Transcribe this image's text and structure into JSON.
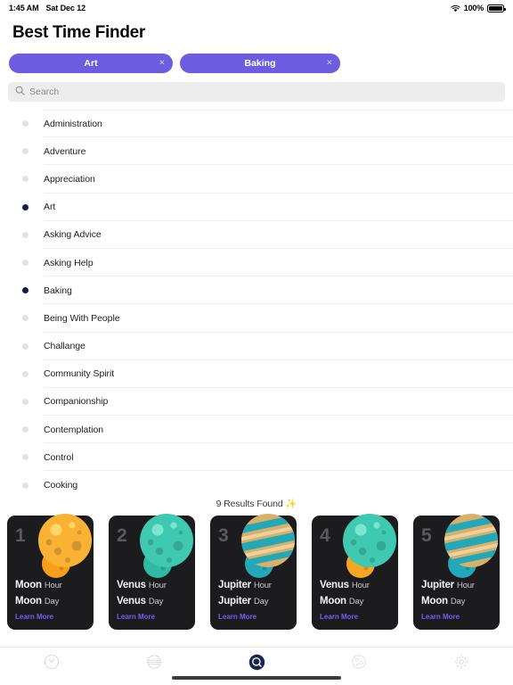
{
  "statusbar": {
    "time": "1:45 AM",
    "date": "Sat Dec 12",
    "battery_pct": "100%",
    "wifi_icon": "wifi-icon",
    "battery_icon": "battery-full-icon"
  },
  "header": {
    "title": "Best Time Finder"
  },
  "chips": [
    {
      "label": "Art",
      "remove_icon": "×"
    },
    {
      "label": "Baking",
      "remove_icon": "×"
    }
  ],
  "search": {
    "placeholder": "Search",
    "value": "",
    "icon": "search-icon"
  },
  "list": {
    "items": [
      {
        "label": "Administration",
        "selected": false
      },
      {
        "label": "Adventure",
        "selected": false
      },
      {
        "label": "Appreciation",
        "selected": false
      },
      {
        "label": "Art",
        "selected": true
      },
      {
        "label": "Asking Advice",
        "selected": false
      },
      {
        "label": "Asking Help",
        "selected": false
      },
      {
        "label": "Baking",
        "selected": true
      },
      {
        "label": "Being With People",
        "selected": false
      },
      {
        "label": "Challange",
        "selected": false
      },
      {
        "label": "Community Spirit",
        "selected": false
      },
      {
        "label": "Companionship",
        "selected": false
      },
      {
        "label": "Contemplation",
        "selected": false
      },
      {
        "label": "Control",
        "selected": false
      },
      {
        "label": "Cooking",
        "selected": false
      }
    ]
  },
  "results": {
    "text": "9 Results Found",
    "sparkle": "✨"
  },
  "cards": [
    {
      "number": "1",
      "hour_planet": "Moon",
      "hour_unit": "Hour",
      "day_planet": "Moon",
      "day_unit": "Day",
      "learn_more": "Learn More",
      "planet_main": "#F9B233",
      "planet_main_light": "#FFD76A",
      "planet_second": "#F79E1B"
    },
    {
      "number": "2",
      "hour_planet": "Venus",
      "hour_unit": "Hour",
      "day_planet": "Venus",
      "day_unit": "Day",
      "learn_more": "Learn More",
      "planet_main": "#3FC9B0",
      "planet_main_light": "#7BE5D2",
      "planet_second": "#2FBBA2"
    },
    {
      "number": "3",
      "hour_planet": "Jupiter",
      "hour_unit": "Hour",
      "day_planet": "Jupiter",
      "day_unit": "Day",
      "learn_more": "Learn More",
      "planet_main": "#D9B06A",
      "planet_main_light": "#EBD2A0",
      "planet_second": "#22A8B8"
    },
    {
      "number": "4",
      "hour_planet": "Venus",
      "hour_unit": "Hour",
      "day_planet": "Moon",
      "day_unit": "Day",
      "learn_more": "Learn More",
      "planet_main": "#3FC9B0",
      "planet_main_light": "#7BE5D2",
      "planet_second": "#F5A623"
    },
    {
      "number": "5",
      "hour_planet": "Jupiter",
      "hour_unit": "Hour",
      "day_planet": "Moon",
      "day_unit": "Day",
      "learn_more": "Learn More",
      "planet_main": "#D9B06A",
      "planet_main_light": "#EBD2A0",
      "planet_second": "#22A8B8"
    }
  ],
  "tabbar": {
    "items": [
      {
        "name": "clock-icon",
        "selected": false
      },
      {
        "name": "jupiter-icon",
        "selected": false
      },
      {
        "name": "search-circle-icon",
        "selected": true
      },
      {
        "name": "moon-icon",
        "selected": false
      },
      {
        "name": "gear-icon",
        "selected": false
      }
    ]
  },
  "colors": {
    "chip": "#6C5CE0",
    "selected_dot": "#161F43",
    "card_bg": "#1C1C1F",
    "learn_more": "#7A5CF0",
    "accent_tab": "#1B2650"
  }
}
